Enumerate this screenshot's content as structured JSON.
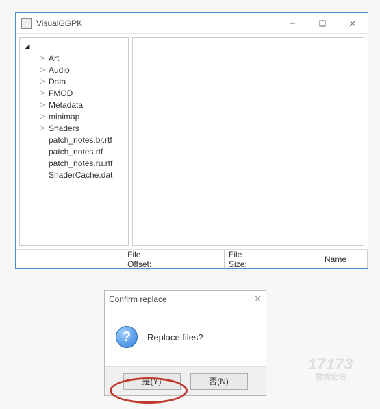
{
  "window": {
    "title": "VisualGGPK"
  },
  "tree": {
    "root_expanded": true,
    "folders": [
      {
        "label": "Art"
      },
      {
        "label": "Audio"
      },
      {
        "label": "Data"
      },
      {
        "label": "FMOD"
      },
      {
        "label": "Metadata"
      },
      {
        "label": "minimap"
      },
      {
        "label": "Shaders"
      }
    ],
    "files": [
      {
        "label": "patch_notes.br.rtf"
      },
      {
        "label": "patch_notes.rtf"
      },
      {
        "label": "patch_notes.ru.rtf"
      },
      {
        "label": "ShaderCache.dat"
      }
    ]
  },
  "status": {
    "file_offset_label": "File Offset:",
    "file_offset_value": "",
    "file_size_label": "File Size:",
    "file_size_value": "",
    "name_label": "Name"
  },
  "dialog": {
    "title": "Confirm replace",
    "message": "Replace files?",
    "yes_label": "是(Y)",
    "no_label": "否(N)"
  },
  "watermark": {
    "line1": "17173",
    "line2": "游戏论坛"
  }
}
